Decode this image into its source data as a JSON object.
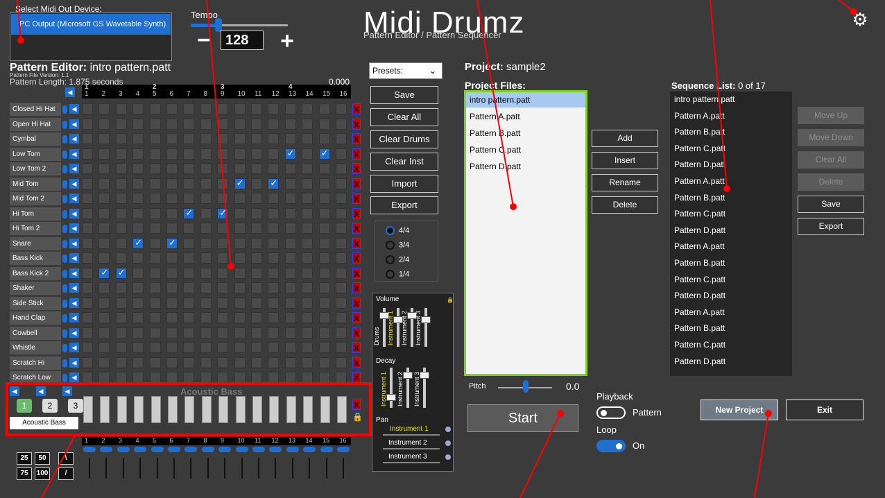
{
  "midi": {
    "label": "Select Midi Out Device:",
    "selected": "PC Output (Microsoft GS Wavetable Synth)"
  },
  "tempo": {
    "label": "Tempo",
    "value": "128",
    "minus": "−",
    "plus": "+",
    "level": 0.25
  },
  "app": {
    "title": "Midi Drumz",
    "subtitle": "Pattern Editor / Pattern Sequencer"
  },
  "pattern_editor": {
    "title_prefix": "Pattern Editor:",
    "title_value": "intro pattern.patt",
    "version": "Pattern File Version: 1.1",
    "length": "Pattern Length: 1.875 seconds",
    "time": "0.000",
    "beats": [
      "1",
      "2",
      "3",
      "4",
      "5",
      "6",
      "7",
      "8",
      "9",
      "10",
      "11",
      "12",
      "13",
      "14",
      "15",
      "16"
    ],
    "bars": [
      "1",
      "2",
      "3",
      "4"
    ],
    "rows": [
      {
        "name": "Closed Hi Hat",
        "on": []
      },
      {
        "name": "Open Hi Hat",
        "on": []
      },
      {
        "name": "Cymbal",
        "on": []
      },
      {
        "name": "Low Tom",
        "on": [
          13,
          15
        ]
      },
      {
        "name": "Low Tom 2",
        "on": []
      },
      {
        "name": "Mid Tom",
        "on": [
          10,
          12
        ]
      },
      {
        "name": "Mid Tom 2",
        "on": []
      },
      {
        "name": "Hi Tom",
        "on": [
          7,
          9
        ]
      },
      {
        "name": "Hi Tom 2",
        "on": []
      },
      {
        "name": "Snare",
        "on": [
          4,
          6
        ]
      },
      {
        "name": "Bass Kick",
        "on": []
      },
      {
        "name": "Bass Kick 2",
        "on": [
          2,
          3
        ]
      },
      {
        "name": "Shaker",
        "on": []
      },
      {
        "name": "Side Stick",
        "on": []
      },
      {
        "name": "Hand Clap",
        "on": []
      },
      {
        "name": "Cowbell",
        "on": []
      },
      {
        "name": "Whistle",
        "on": []
      },
      {
        "name": "Scratch Hi",
        "on": []
      },
      {
        "name": "Scratch Low",
        "on": []
      }
    ],
    "x_label": "X"
  },
  "instrument": {
    "label": "Acoustic Bass",
    "buttons": [
      "1",
      "2",
      "3"
    ],
    "name": "Acoustic Bass"
  },
  "velocity": {
    "buttons": [
      "25",
      "50",
      "\\",
      "75",
      "100",
      "/"
    ]
  },
  "presets": {
    "label": "Presets:"
  },
  "buttons": {
    "save": "Save",
    "clear_all": "Clear All",
    "clear_drums": "Clear Drums",
    "clear_inst": "Clear Inst",
    "import": "Import",
    "export": "Export"
  },
  "meter": {
    "options": [
      "4/4",
      "3/4",
      "2/4",
      "1/4"
    ],
    "selected": "4/4"
  },
  "mixer": {
    "volume": "Volume",
    "decay": "Decay",
    "pan": "Pan",
    "channels_volume": [
      "Drums",
      "Instrument 1",
      "Instrument 2",
      "Instrument 3"
    ],
    "channels_decay": [
      "Instrument 1",
      "Instrument 2",
      "Instrument 3"
    ],
    "pan_channels": [
      "Instrument 1",
      "Instrument 2",
      "Instrument 3"
    ],
    "highlight_color": "#e8e800"
  },
  "project": {
    "label": "Project:",
    "name": "sample2",
    "files_label": "Project Files:",
    "files": [
      "intro pattern.patt",
      "Pattern A.patt",
      "Pattern B.patt",
      "Pattern C.patt",
      "Pattern D.patt"
    ],
    "selected_index": 0
  },
  "actions": {
    "add": "Add",
    "insert": "Insert",
    "rename": "Rename",
    "delete": "Delete"
  },
  "pitch": {
    "label": "Pitch",
    "value": "0.0"
  },
  "start": "Start",
  "playback": {
    "label": "Playback",
    "toggle_text": "Pattern",
    "loop_label": "Loop",
    "loop_text": "On"
  },
  "sequence": {
    "label": "Sequence List:",
    "count": "0 of 17",
    "items": [
      "intro pattern.patt",
      "Pattern A.patt",
      "Pattern B.patt",
      "Pattern C.patt",
      "Pattern D.patt",
      "Pattern A.patt",
      "Pattern B.patt",
      "Pattern C.patt",
      "Pattern D.patt",
      "Pattern A.patt",
      "Pattern B.patt",
      "Pattern C.patt",
      "Pattern D.patt",
      "Pattern A.patt",
      "Pattern B.patt",
      "Pattern C.patt",
      "Pattern D.patt"
    ],
    "buttons": {
      "move_up": "Move Up",
      "move_down": "Move Down",
      "clear_all": "Clear All",
      "delete": "Delete",
      "save": "Save",
      "export": "Export"
    }
  },
  "new_project": "New Project",
  "exit": "Exit",
  "colors": {
    "accent": "#1e6fd0",
    "files_border": "#7ed321",
    "annotation": "#ff0000"
  }
}
